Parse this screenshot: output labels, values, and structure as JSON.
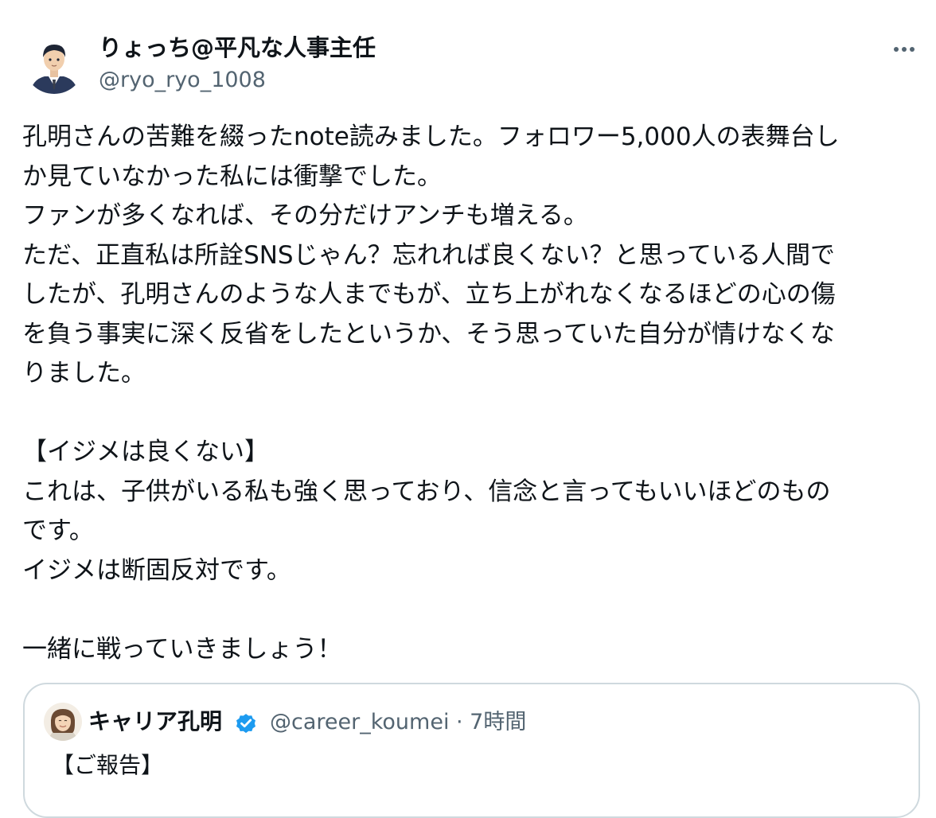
{
  "author": {
    "display_name": "りょっち@平凡な人事主任",
    "handle": "@ryo_ryo_1008",
    "avatar_icon": "businessman-illustration-avatar"
  },
  "more_icon": "more-horizontal-icon",
  "tweet": {
    "lines": [
      "孔明さんの苦難を綴ったnote読みました。フォロワー5,000人の表舞台し",
      "か見ていなかった私には衝撃でした。",
      "ファンが多くなれば、その分だけアンチも増える。",
      "ただ、正直私は所詮SNSじゃん？忘れれば良くない？と思っている人間で",
      "したが、孔明さんのような人までもが、立ち上がれなくなるほどの心の傷",
      "を負う事実に深く反省をしたというか、そう思っていた自分が情けなくな",
      "りました。",
      "",
      "【イジメは良くない】",
      "これは、子供がいる私も強く思っており、信念と言ってもいいほどのもの",
      "です。",
      "イジメは断固反対です。",
      "",
      "一緒に戦っていきましょう！"
    ]
  },
  "quote": {
    "display_name": "キャリア孔明",
    "handle_time": "@career_koumei · 7時間",
    "text": "【ご報告】",
    "avatar_icon": "illustrated-person-avatar",
    "verified_icon": "verified-badge-icon",
    "verified_color": "#1d9bf0"
  }
}
